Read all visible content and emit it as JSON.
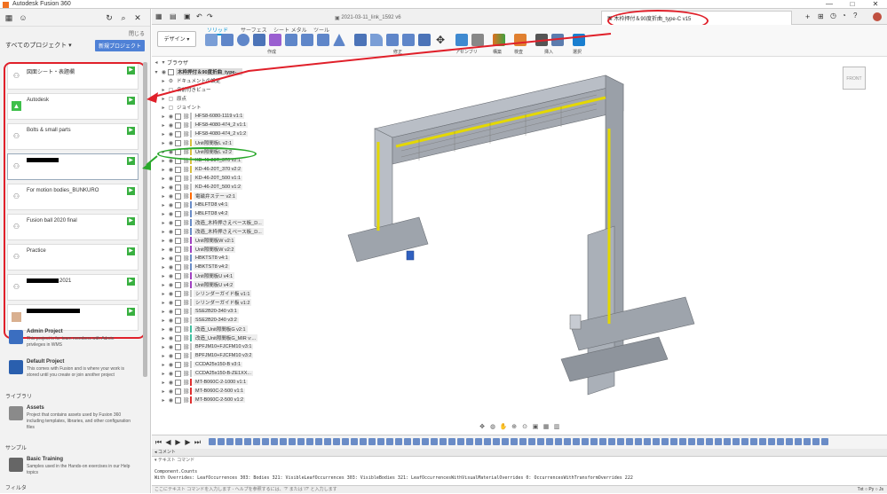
{
  "window": {
    "title": "Autodesk Fusion 360",
    "controls": [
      "—",
      "□",
      "✕"
    ]
  },
  "data_panel": {
    "header_hint": "閉じる",
    "all_projects_label": "すべてのプロジェクト",
    "new_project_label": "新規プロジェクト",
    "projects": [
      {
        "name": "図面シート・表題欄",
        "icon": "people-icon"
      },
      {
        "name": "Autodesk",
        "icon": "green-folder-icon"
      },
      {
        "name": "Bolts & small parts",
        "icon": "people-icon"
      },
      {
        "name": "",
        "icon": "people-icon",
        "redacted": true
      },
      {
        "name": "For motion bodies_BUNKURO",
        "icon": "people-icon"
      },
      {
        "name": "Fusion ball 2020 final",
        "icon": "people-icon"
      },
      {
        "name": "Practice",
        "icon": "people-icon"
      },
      {
        "name": "2021",
        "icon": "people-icon",
        "redacted": true
      },
      {
        "name": "",
        "icon": "photo-icon",
        "redacted": true
      }
    ],
    "extra_projects": [
      {
        "name": "Admin Project",
        "desc": "This project is for team members with Admin privileges in WMS"
      },
      {
        "name": "Default Project",
        "desc": "This comes with Fusion and is where your work is stored until you create or join another project"
      }
    ],
    "library_label": "ライブラリ",
    "library": {
      "name": "Assets",
      "desc": "Project that contains assets used by Fusion 360 including templates, libraries, and other configuration files"
    },
    "samples_label": "サンプル",
    "samples": {
      "name": "Basic Training",
      "desc": "Samples used in the Hands-on exercises in our Help topics"
    },
    "filter_label": "フィルタ"
  },
  "tabs": [
    {
      "label": "2021-03-11_link_1592 v6"
    },
    {
      "label": "木枠押付＆90度折曲_type-C v15",
      "active": true
    }
  ],
  "workspace": {
    "design_label": "デザイン",
    "tabs": [
      "ソリッド",
      "サーフェス",
      "シート メタル",
      "ツール"
    ],
    "groups": [
      "作成",
      "修正",
      "アセンブリ",
      "構築",
      "検査",
      "挿入",
      "選択"
    ]
  },
  "browser": {
    "title": "ブラウザ",
    "root": "木枠押付＆90度折曲_type-...",
    "folders": [
      "ドキュメントの設定",
      "名前付きビュー",
      "原点",
      "ジョイント"
    ],
    "rows": [
      {
        "label": "HFS8-6080-1119 v1:1",
        "color": "#c0c0c0"
      },
      {
        "label": "HFS8-4080-474_2 v1:1",
        "color": "#c0c0c0"
      },
      {
        "label": "HFS8-4080-474_2 v1:2",
        "color": "#c0c0c0"
      },
      {
        "label": "Unit隙間板L v2:1",
        "color": "#d8c040"
      },
      {
        "label": "Unit隙間板L v2:2",
        "color": "#d8c040"
      },
      {
        "label": "KD-46-20T_370 v2:1",
        "color": "#d8c040"
      },
      {
        "label": "KD-46-20T_370 v2:2",
        "color": "#d8c040"
      },
      {
        "label": "KD-46-20T_500 v1:1",
        "color": "#c0c0c0"
      },
      {
        "label": "KD-46-20T_500 v1:2",
        "color": "#c0c0c0"
      },
      {
        "label": "電磁弁ステー v2:1",
        "color": "#ff6a00"
      },
      {
        "label": "HBLFTD8 v4:1",
        "color": "#6a8cc7"
      },
      {
        "label": "HBLFTD8 v4:2",
        "color": "#6a8cc7"
      },
      {
        "label": "改造_木枠押さえベース板_D...",
        "color": "#6a8cc7"
      },
      {
        "label": "改造_木枠押さえベース板_D...",
        "color": "#6a8cc7"
      },
      {
        "label": "Unit隙間板W v2:1",
        "color": "#a040c0"
      },
      {
        "label": "Unit隙間板W v2:2",
        "color": "#a040c0"
      },
      {
        "label": "HBKTST8 v4:1",
        "color": "#6a8cc7"
      },
      {
        "label": "HBKTST8 v4:2",
        "color": "#6a8cc7"
      },
      {
        "label": "Unit隙間板U v4:1",
        "color": "#a040c0"
      },
      {
        "label": "Unit隙間板U v4:2",
        "color": "#a040c0"
      },
      {
        "label": "シリンダーガイド板 v1:1",
        "color": "#c0c0c0"
      },
      {
        "label": "シリンダーガイド板 v1:2",
        "color": "#c0c0c0"
      },
      {
        "label": "SSE2B20-340 v3:1",
        "color": "#c0c0c0"
      },
      {
        "label": "SSE2B20-340 v3:2",
        "color": "#c0c0c0"
      },
      {
        "label": "改造_Unit隙間板G v2:1",
        "color": "#40c0a0"
      },
      {
        "label": "改造_Unit隙間板G_MIR v:...",
        "color": "#40c0a0"
      },
      {
        "label": "BPFJM10+FJCFM10 v3:1",
        "color": "#c0c0c0"
      },
      {
        "label": "BPFJM10+FJCFM10 v3:2",
        "color": "#c0c0c0"
      },
      {
        "label": "CCDA25x150-B v3:1",
        "color": "#c0c0c0"
      },
      {
        "label": "CCDA25x150-B-ZE1XX...",
        "color": "#c0c0c0"
      },
      {
        "label": "MT-B060C-2-1000 v1:1",
        "color": "#e03030"
      },
      {
        "label": "MT-B060C-2-500 v1:1",
        "color": "#e03030"
      },
      {
        "label": "MT-B060C-2-500 v1:2",
        "color": "#e03030"
      }
    ]
  },
  "comment_label": "コメント",
  "text_commands": {
    "title": "テキスト コマンド",
    "line1": "Component.Counts",
    "line2": "With Overrides: LeafOccurrences 303: Bodies 321: VisibleLeafOccurrences 303: VisibleBodies 321: LeafOccurrencesWithVisualMaterialOverrides 0: OccurrencesWithTransformOverrides 222",
    "prompt": "ここにテキスト コマンドを入力します - ヘルプを参照するには、'?' または '/?' と入力します",
    "langs": "Txt ○ Py ○ Js"
  },
  "colors": {
    "accent": "#0696d7",
    "annotation_red": "#e0202a",
    "annotation_green": "#29a82b",
    "folder_green": "#38b040"
  }
}
